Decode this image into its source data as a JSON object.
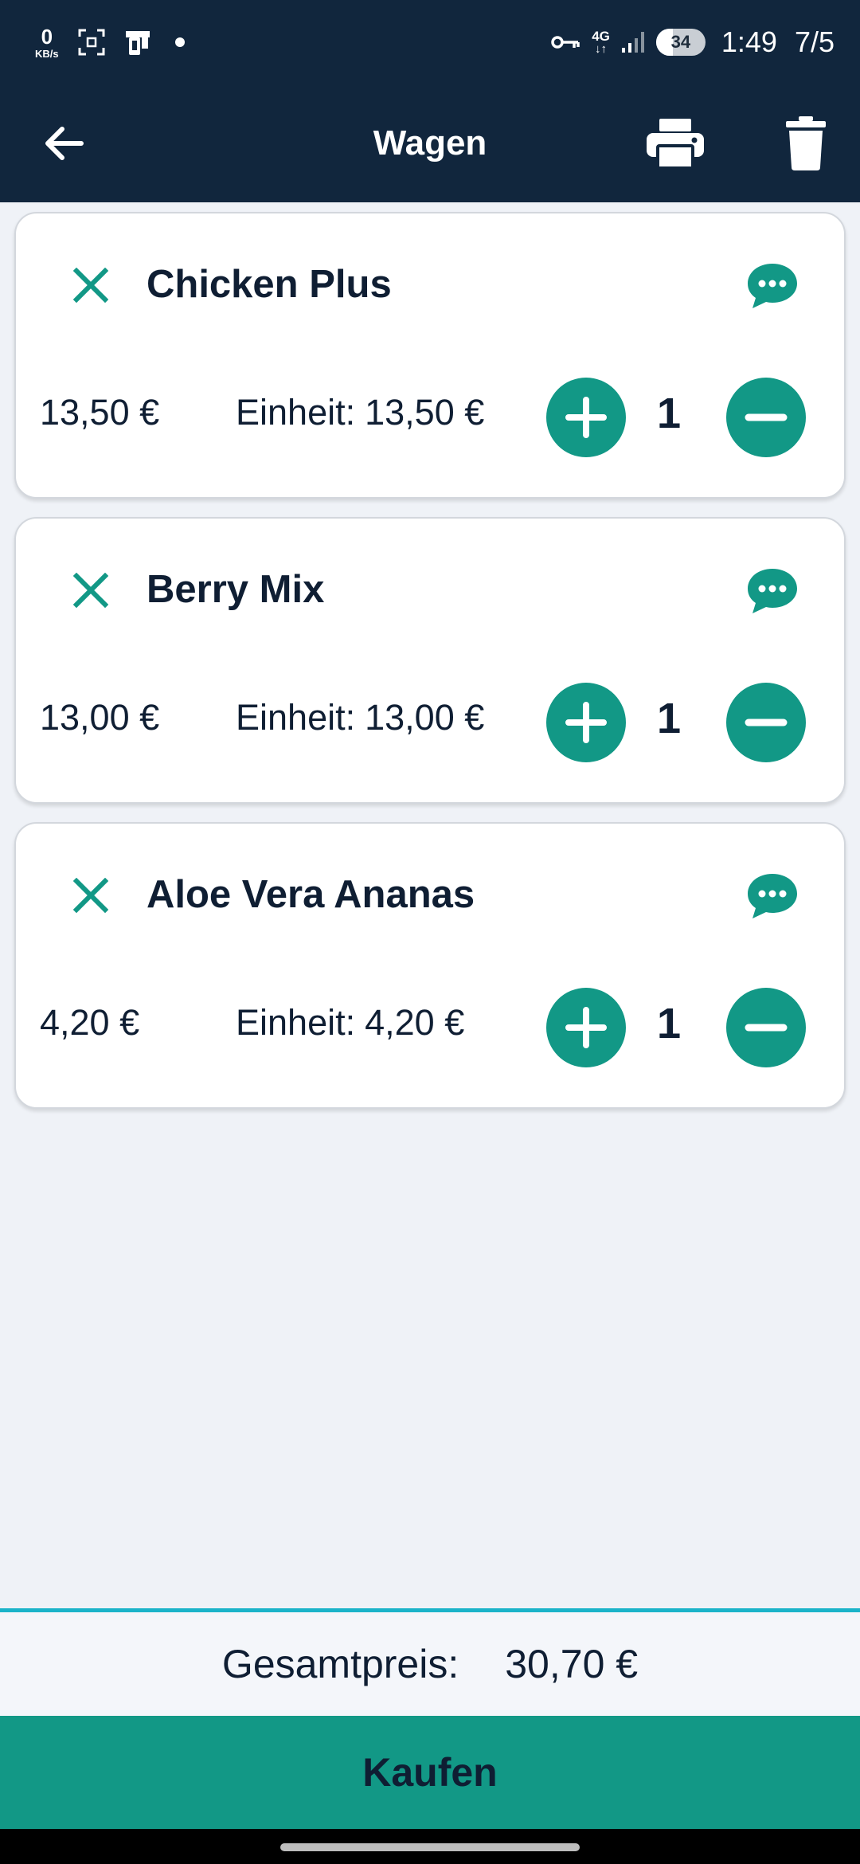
{
  "status_bar": {
    "net_speed_value": "0",
    "net_speed_unit": "KB/s",
    "network_type": "4G",
    "network_arrows": "↓↑",
    "battery_level": "34",
    "battery_fraction": 0.34,
    "time": "1:49",
    "page_indicator": "7/5"
  },
  "app_bar": {
    "title": "Wagen",
    "icons": {
      "back": "arrow-left-icon",
      "print": "printer-icon",
      "delete": "trash-icon"
    }
  },
  "cart": {
    "currency_note": "€",
    "items": [
      {
        "name": "Chicken Plus",
        "price": "13,50 €",
        "unit_label": "Einheit:",
        "unit_price": "13,50 €",
        "quantity": "1"
      },
      {
        "name": "Berry Mix",
        "price": "13,00 €",
        "unit_label": "Einheit:",
        "unit_price": "13,00 €",
        "quantity": "1"
      },
      {
        "name": "Aloe Vera Ananas",
        "price": "4,20 €",
        "unit_label": "Einheit:",
        "unit_price": "4,20 €",
        "quantity": "1"
      }
    ]
  },
  "footer": {
    "total_label": "Gesamtpreis:",
    "total_value": "30,70 €",
    "buy_label": "Kaufen"
  },
  "colors": {
    "header_bg": "#11263d",
    "accent_teal": "#129886",
    "divider_cyan": "#1ab3c9",
    "text_dark": "#0f1e33",
    "background": "#eff2f7"
  }
}
